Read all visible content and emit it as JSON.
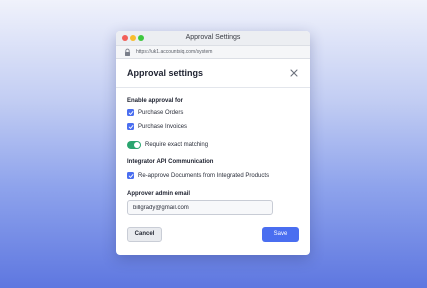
{
  "window": {
    "title": "Approval Settings",
    "url": "https://uk1.accountsiq.com/system"
  },
  "panel": {
    "title": "Approval settings"
  },
  "enable_section": {
    "label": "Enable approval for",
    "items": [
      {
        "label": "Purchase Orders",
        "checked": true
      },
      {
        "label": "Purchase Invoices",
        "checked": true
      }
    ]
  },
  "matching": {
    "label": "Require exact matching",
    "on": true
  },
  "integrator_section": {
    "label": "Integrator API Communication",
    "items": [
      {
        "label": "Re-approve Documents from Integrated Products",
        "checked": true
      }
    ]
  },
  "email": {
    "label": "Approver admin email",
    "value": "billgrady@gmail.com"
  },
  "buttons": {
    "cancel": "Cancel",
    "save": "Save"
  },
  "colors": {
    "accent": "#4a6ef0",
    "toggle_on": "#2aa56f"
  },
  "icons": {
    "lock": "lock-icon",
    "close": "close-icon",
    "check": "checkmark-icon"
  }
}
